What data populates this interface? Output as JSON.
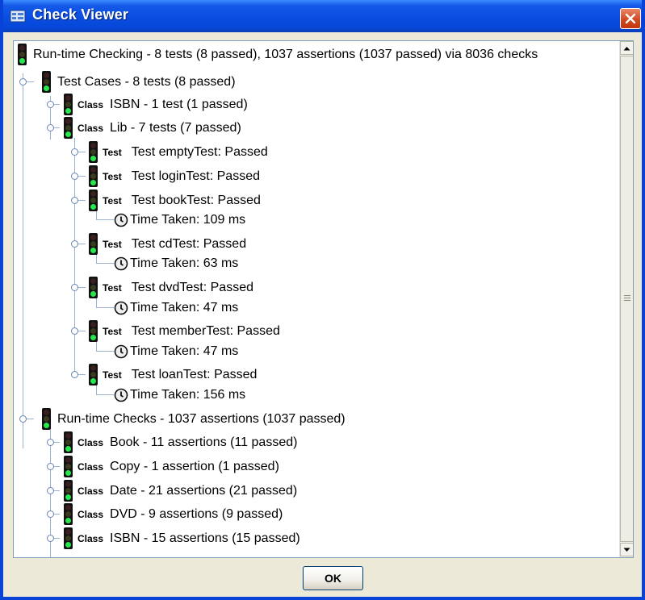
{
  "window": {
    "title": "Check Viewer",
    "ok_label": "OK",
    "colors": {
      "titlebar": "#0a4de0",
      "close": "#d0451b",
      "signal_green": "#27e64e"
    }
  },
  "tree": {
    "root": "Run-time Checking - 8 tests (8 passed), 1037 assertions (1037 passed) via 8036 checks",
    "test_cases": {
      "label": "Test Cases - 8 tests (8 passed)",
      "classes": [
        {
          "tag": "Class",
          "label": "ISBN - 1 test (1 passed)"
        },
        {
          "tag": "Class",
          "label": "Lib - 7 tests (7 passed)"
        }
      ],
      "tests": [
        {
          "tag": "Test",
          "label": "Test emptyTest: Passed"
        },
        {
          "tag": "Test",
          "label": "Test loginTest: Passed"
        },
        {
          "tag": "Test",
          "label": "Test bookTest: Passed",
          "time": "Time Taken: 109 ms"
        },
        {
          "tag": "Test",
          "label": "Test cdTest: Passed",
          "time": "Time Taken: 63 ms"
        },
        {
          "tag": "Test",
          "label": "Test dvdTest: Passed",
          "time": "Time Taken: 47 ms"
        },
        {
          "tag": "Test",
          "label": "Test memberTest: Passed",
          "time": "Time Taken: 47 ms"
        },
        {
          "tag": "Test",
          "label": "Test loanTest: Passed",
          "time": "Time Taken: 156 ms"
        }
      ]
    },
    "runtime_checks": {
      "label": "Run-time Checks - 1037 assertions (1037 passed)",
      "classes": [
        {
          "tag": "Class",
          "label": "Book - 11 assertions (11 passed)"
        },
        {
          "tag": "Class",
          "label": "Copy - 1 assertion (1 passed)"
        },
        {
          "tag": "Class",
          "label": "Date - 21 assertions (21 passed)"
        },
        {
          "tag": "Class",
          "label": "DVD - 9 assertions (9 passed)"
        },
        {
          "tag": "Class",
          "label": "ISBN - 15 assertions (15 passed)"
        }
      ]
    }
  }
}
